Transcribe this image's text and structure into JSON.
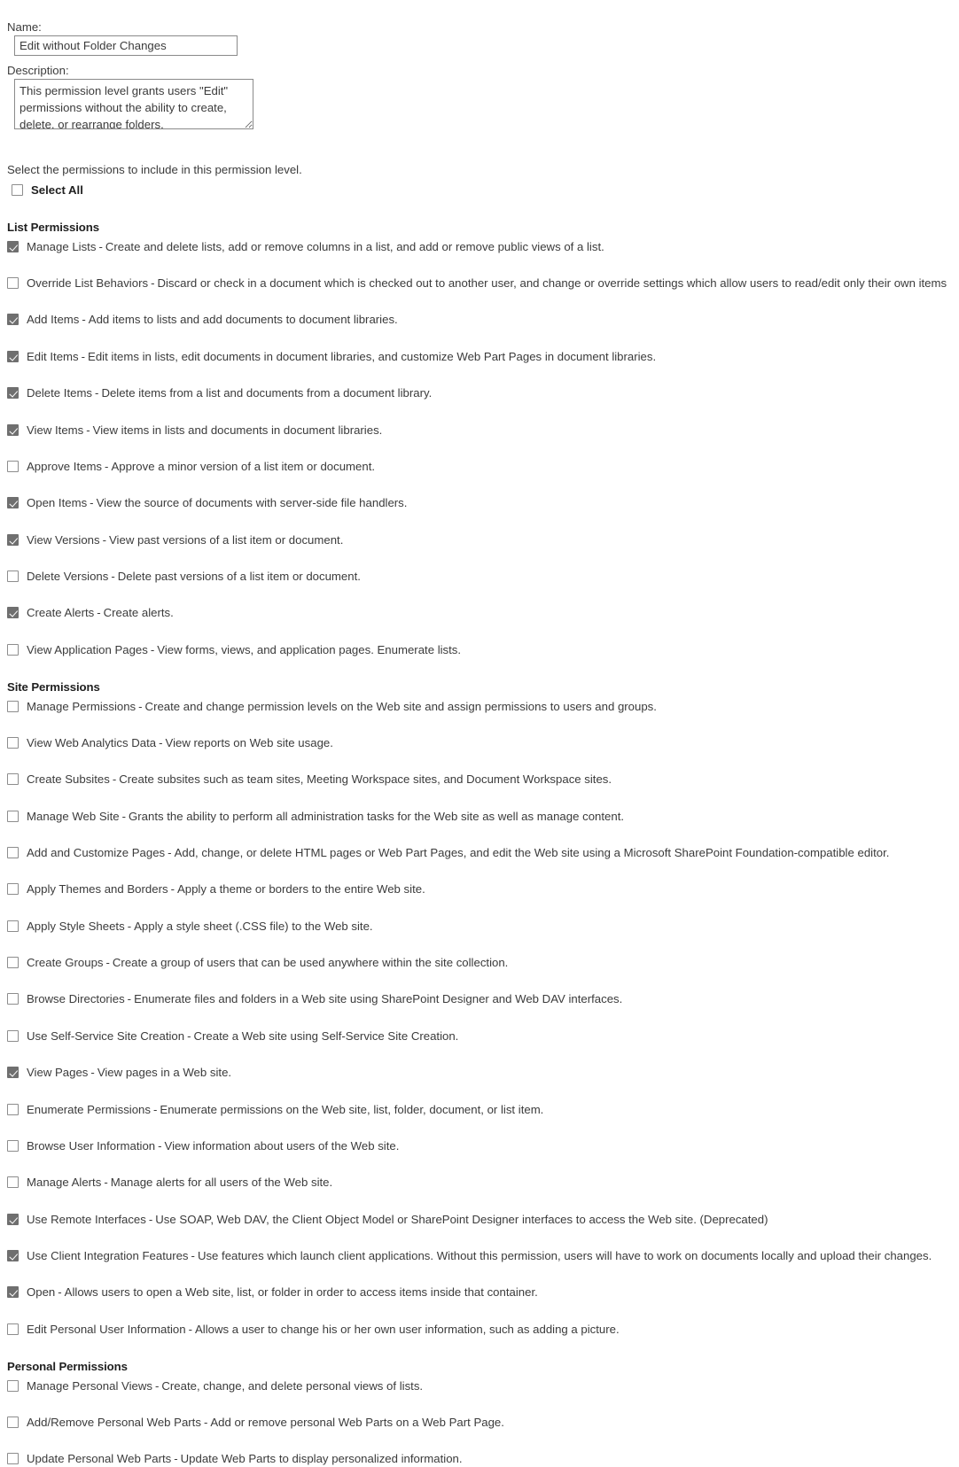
{
  "form": {
    "name_label": "Name:",
    "name_value": "Edit without Folder Changes",
    "description_label": "Description:",
    "description_value": "This permission level grants users \"Edit\" permissions without the ability to create, delete, or rearrange folders."
  },
  "instruction": "Select the permissions to include in this permission level.",
  "select_all": {
    "label": "Select All",
    "checked": false
  },
  "colors": {
    "text": "#3b3b3b",
    "heading": "#1f1f1f",
    "checkbox_border": "#8d8d8d",
    "checkbox_checked_fill": "#6f6f6f",
    "input_border": "#8a8a8a",
    "background": "#ffffff"
  },
  "sections": [
    {
      "title": "List Permissions",
      "items": [
        {
          "checked": true,
          "name": "Manage Lists",
          "dash": "-",
          "description": "Create and delete lists, add or remove columns in a list, and add or remove public views of a list."
        },
        {
          "checked": false,
          "name": "Override List Behaviors",
          "dash": "-",
          "description": "Discard or check in a document which is checked out to another user, and change or override settings which allow users to read/edit only their own items"
        },
        {
          "checked": true,
          "name": "Add Items",
          "dash": "-",
          "description": "Add items to lists and add documents to document libraries."
        },
        {
          "checked": true,
          "name": "Edit Items",
          "dash": "-",
          "description": "Edit items in lists, edit documents in document libraries, and customize Web Part Pages in document libraries."
        },
        {
          "checked": true,
          "name": "Delete Items",
          "dash": "-",
          "description": "Delete items from a list and documents from a document library."
        },
        {
          "checked": true,
          "name": "View Items",
          "dash": "-",
          "description": "View items in lists and documents in document libraries."
        },
        {
          "checked": false,
          "name": "Approve Items",
          "dash": "-",
          "description": "Approve a minor version of a list item or document."
        },
        {
          "checked": true,
          "name": "Open Items",
          "dash": "-",
          "description": "View the source of documents with server-side file handlers."
        },
        {
          "checked": true,
          "name": "View Versions",
          "dash": "-",
          "description": "View past versions of a list item or document."
        },
        {
          "checked": false,
          "name": "Delete Versions",
          "dash": "-",
          "description": "Delete past versions of a list item or document."
        },
        {
          "checked": true,
          "name": "Create Alerts",
          "dash": "-",
          "description": "Create alerts."
        },
        {
          "checked": false,
          "name": "View Application Pages",
          "dash": "-",
          "description": "View forms, views, and application pages. Enumerate lists."
        }
      ]
    },
    {
      "title": "Site Permissions",
      "items": [
        {
          "checked": false,
          "name": "Manage Permissions",
          "dash": "-",
          "description": "Create and change permission levels on the Web site and assign permissions to users and groups."
        },
        {
          "checked": false,
          "name": "View Web Analytics Data",
          "dash": "-",
          "description": "View reports on Web site usage."
        },
        {
          "checked": false,
          "name": "Create Subsites",
          "dash": "-",
          "description": "Create subsites such as team sites, Meeting Workspace sites, and Document Workspace sites."
        },
        {
          "checked": false,
          "name": "Manage Web Site",
          "dash": "-",
          "description": "Grants the ability to perform all administration tasks for the Web site as well as manage content."
        },
        {
          "checked": false,
          "name": "Add and Customize Pages",
          "dash": "-",
          "description": "Add, change, or delete HTML pages or Web Part Pages, and edit the Web site using a Microsoft SharePoint Foundation-compatible editor."
        },
        {
          "checked": false,
          "name": "Apply Themes and Borders",
          "dash": "-",
          "description": "Apply a theme or borders to the entire Web site."
        },
        {
          "checked": false,
          "name": "Apply Style Sheets",
          "dash": "-",
          "description": "Apply a style sheet (.CSS file) to the Web site."
        },
        {
          "checked": false,
          "name": "Create Groups",
          "dash": "-",
          "description": "Create a group of users that can be used anywhere within the site collection."
        },
        {
          "checked": false,
          "name": "Browse Directories",
          "dash": "-",
          "description": "Enumerate files and folders in a Web site using SharePoint Designer and Web DAV interfaces."
        },
        {
          "checked": false,
          "name": "Use Self-Service Site Creation",
          "dash": "-",
          "description": "Create a Web site using Self-Service Site Creation."
        },
        {
          "checked": true,
          "name": "View Pages",
          "dash": "-",
          "description": "View pages in a Web site."
        },
        {
          "checked": false,
          "name": "Enumerate Permissions",
          "dash": "-",
          "description": "Enumerate permissions on the Web site, list, folder, document, or list item."
        },
        {
          "checked": false,
          "name": "Browse User Information",
          "dash": "-",
          "description": "View information about users of the Web site."
        },
        {
          "checked": false,
          "name": "Manage Alerts",
          "dash": "-",
          "description": "Manage alerts for all users of the Web site."
        },
        {
          "checked": true,
          "name": "Use Remote Interfaces",
          "dash": "-",
          "description": "Use SOAP, Web DAV, the Client Object Model or SharePoint Designer interfaces to access the Web site. (Deprecated)"
        },
        {
          "checked": true,
          "name": "Use Client Integration Features",
          "dash": "-",
          "description": "Use features which launch client applications. Without this permission, users will have to work on documents locally and upload their changes."
        },
        {
          "checked": true,
          "name": "Open",
          "dash": "-",
          "description": "Allows users to open a Web site, list, or folder in order to access items inside that container."
        },
        {
          "checked": false,
          "name": "Edit Personal User Information",
          "dash": "-",
          "description": "Allows a user to change his or her own user information, such as adding a picture."
        }
      ]
    },
    {
      "title": "Personal Permissions",
      "items": [
        {
          "checked": false,
          "name": "Manage Personal Views",
          "dash": "-",
          "description": "Create, change, and delete personal views of lists."
        },
        {
          "checked": false,
          "name": "Add/Remove Personal Web Parts",
          "dash": "-",
          "description": "Add or remove personal Web Parts on a Web Part Page."
        },
        {
          "checked": false,
          "name": "Update Personal Web Parts",
          "dash": "-",
          "description": "Update Web Parts to display personalized information."
        }
      ]
    }
  ]
}
